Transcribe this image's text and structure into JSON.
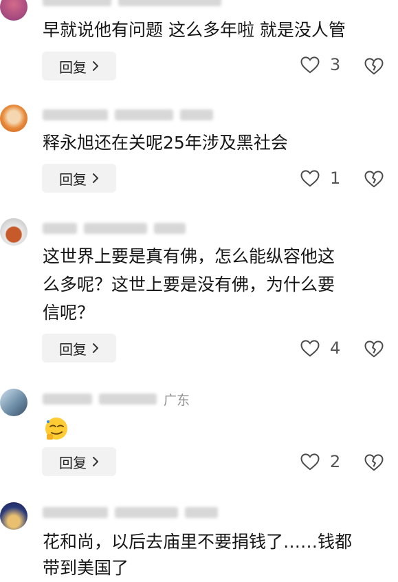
{
  "comments": [
    {
      "location": "",
      "text": "早就说他有问题 这么多年啦 就是没人管",
      "reply_label": "回复",
      "likes": "3"
    },
    {
      "location": "",
      "text": "释永旭还在关呢25年涉及黑社会",
      "reply_label": "回复",
      "likes": "1"
    },
    {
      "location": "",
      "text_line1": "这世界上要是真有佛，怎么能纵容他这",
      "text_line2": "么多呢？这世上要是没有佛，为什么要",
      "text_line3": "信呢？",
      "reply_label": "回复",
      "likes": "4"
    },
    {
      "location": "广东",
      "text": "",
      "emoji": "smirking-face-emoji",
      "reply_label": "回复",
      "likes": "2"
    },
    {
      "location": "",
      "text_line1": "花和尚，以后去庙里不要捐钱了……钱都",
      "text_line2": "带到美国了"
    }
  ],
  "icons": {
    "like": "heart-outline-icon",
    "dislike": "broken-heart-icon",
    "reply_arrow": "chevron-right-icon"
  },
  "colors": {
    "text": "#161616",
    "meta": "#8f8f8f",
    "button_bg": "#f2f2f2",
    "icon": "#4a4a4a"
  }
}
